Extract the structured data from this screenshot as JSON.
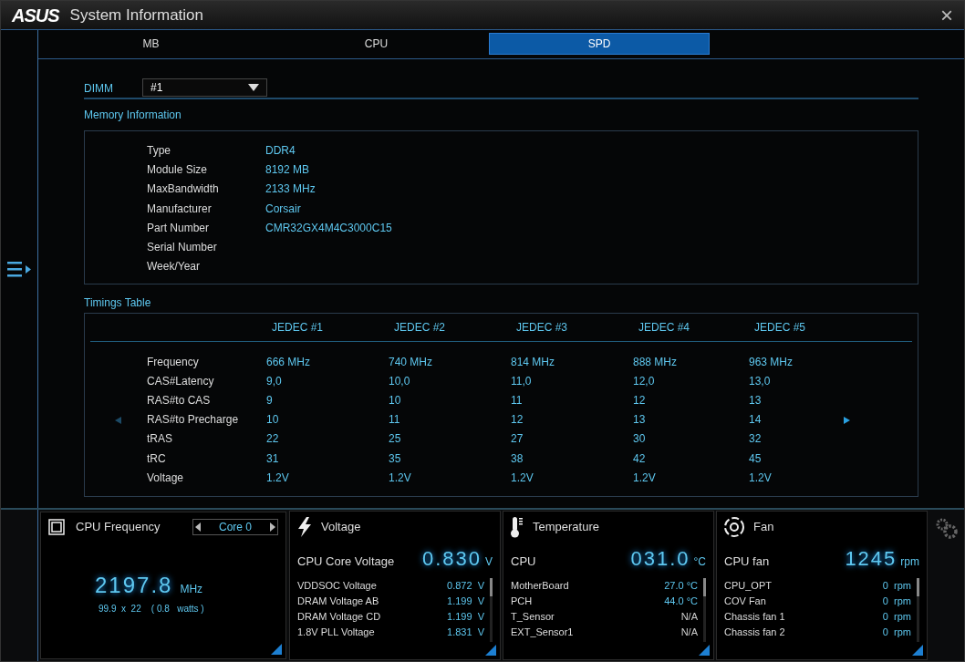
{
  "window": {
    "logo": "ASUS",
    "title": "System Information",
    "close": "×"
  },
  "tabs": [
    {
      "label": "MB",
      "selected": false
    },
    {
      "label": "CPU",
      "selected": false
    },
    {
      "label": "SPD",
      "selected": true
    }
  ],
  "dimm": {
    "label": "DIMM",
    "value": "#1"
  },
  "memory_information": {
    "title": "Memory Information",
    "rows": [
      {
        "label": "Type",
        "value": "DDR4"
      },
      {
        "label": "Module Size",
        "value": "8192 MB"
      },
      {
        "label": "MaxBandwidth",
        "value": "2133 MHz"
      },
      {
        "label": "Manufacturer",
        "value": "Corsair"
      },
      {
        "label": "Part Number",
        "value": "CMR32GX4M4C3000C15"
      },
      {
        "label": "Serial Number",
        "value": ""
      },
      {
        "label": "Week/Year",
        "value": ""
      }
    ]
  },
  "timings_table": {
    "title": "Timings Table",
    "columns": [
      "JEDEC #1",
      "JEDEC #2",
      "JEDEC #3",
      "JEDEC #4",
      "JEDEC #5"
    ],
    "rows": [
      {
        "label": "Frequency",
        "values": [
          "666 MHz",
          "740 MHz",
          "814 MHz",
          "888 MHz",
          "963 MHz"
        ]
      },
      {
        "label": "CAS#Latency",
        "values": [
          "9,0",
          "10,0",
          "11,0",
          "12,0",
          "13,0"
        ]
      },
      {
        "label": "RAS#to CAS",
        "values": [
          "9",
          "10",
          "11",
          "12",
          "13"
        ]
      },
      {
        "label": "RAS#to Precharge",
        "values": [
          "10",
          "11",
          "12",
          "13",
          "14"
        ]
      },
      {
        "label": "tRAS",
        "values": [
          "22",
          "25",
          "27",
          "30",
          "32"
        ]
      },
      {
        "label": "tRC",
        "values": [
          "31",
          "35",
          "38",
          "42",
          "45"
        ]
      },
      {
        "label": "Voltage",
        "values": [
          "1.2V",
          "1.2V",
          "1.2V",
          "1.2V",
          "1.2V"
        ]
      }
    ]
  },
  "cpu_frequency": {
    "title": "CPU Frequency",
    "core": "Core 0",
    "value": "2197.8",
    "unit": "MHz",
    "detail": "99.9  x  22    ( 0.8   watts )"
  },
  "monitors": [
    {
      "kind": "voltage",
      "title": "Voltage",
      "label": "CPU Core Voltage",
      "value": "0.830",
      "unit": "V",
      "rows": [
        {
          "label": "VDDSOC Voltage",
          "value": "0.872  V",
          "available": true
        },
        {
          "label": "DRAM Voltage AB",
          "value": "1.199  V",
          "available": true
        },
        {
          "label": "DRAM Voltage CD",
          "value": "1.199  V",
          "available": true
        },
        {
          "label": "1.8V PLL Voltage",
          "value": "1.831  V",
          "available": true
        }
      ]
    },
    {
      "kind": "temperature",
      "title": "Temperature",
      "label": "CPU",
      "value": "031.0",
      "unit": "°C",
      "rows": [
        {
          "label": "MotherBoard",
          "value": "27.0 °C",
          "available": true
        },
        {
          "label": "PCH",
          "value": "44.0 °C",
          "available": true
        },
        {
          "label": "T_Sensor",
          "value": "N/A",
          "available": false
        },
        {
          "label": "EXT_Sensor1",
          "value": "N/A",
          "available": false
        }
      ]
    },
    {
      "kind": "fan",
      "title": "Fan",
      "label": "CPU fan",
      "value": "1245",
      "unit": "rpm",
      "rows": [
        {
          "label": "CPU_OPT",
          "value": "0  rpm",
          "available": true
        },
        {
          "label": "COV Fan",
          "value": "0  rpm",
          "available": true
        },
        {
          "label": "Chassis fan 1",
          "value": "0  rpm",
          "available": true
        },
        {
          "label": "Chassis fan 2",
          "value": "0  rpm",
          "available": true
        }
      ]
    }
  ]
}
